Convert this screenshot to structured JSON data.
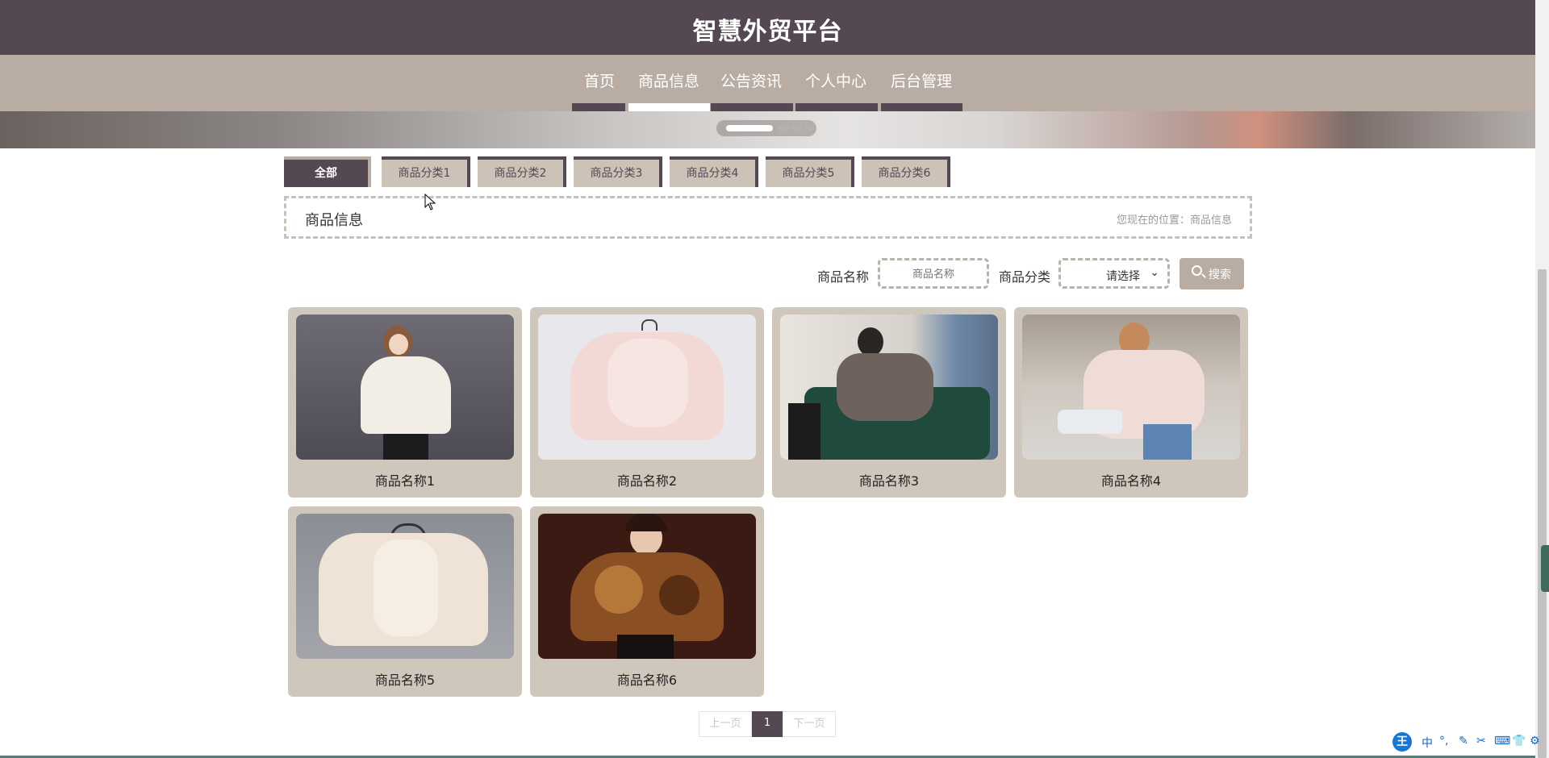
{
  "header": {
    "title": "智慧外贸平台"
  },
  "nav": {
    "items": [
      {
        "label": "首页"
      },
      {
        "label": "商品信息"
      },
      {
        "label": "公告资讯"
      },
      {
        "label": "个人中心"
      },
      {
        "label": "后台管理"
      }
    ],
    "active_index": 1
  },
  "carousel": {
    "slide_count": 4,
    "active_index": 0
  },
  "categories": {
    "items": [
      {
        "label": "全部"
      },
      {
        "label": "商品分类1"
      },
      {
        "label": "商品分类2"
      },
      {
        "label": "商品分类3"
      },
      {
        "label": "商品分类4"
      },
      {
        "label": "商品分类5"
      },
      {
        "label": "商品分类6"
      }
    ],
    "active_index": 0
  },
  "breadcrumb": {
    "title": "商品信息",
    "location": "您现在的位置：商品信息"
  },
  "search": {
    "name_label": "商品名称",
    "name_placeholder": "商品名称",
    "category_label": "商品分类",
    "category_selected": "请选择",
    "button_label": "搜索"
  },
  "products": [
    {
      "name": "商品名称1"
    },
    {
      "name": "商品名称2"
    },
    {
      "name": "商品名称3"
    },
    {
      "name": "商品名称4"
    },
    {
      "name": "商品名称5"
    },
    {
      "name": "商品名称6"
    }
  ],
  "pagination": {
    "prev": "上一页",
    "current": "1",
    "next": "下一页"
  },
  "ime_toolbar": {
    "logo": "王",
    "mode": "中"
  },
  "colors": {
    "primary": "#544852",
    "secondary": "#b8aca3",
    "card": "#cfc6bc"
  }
}
